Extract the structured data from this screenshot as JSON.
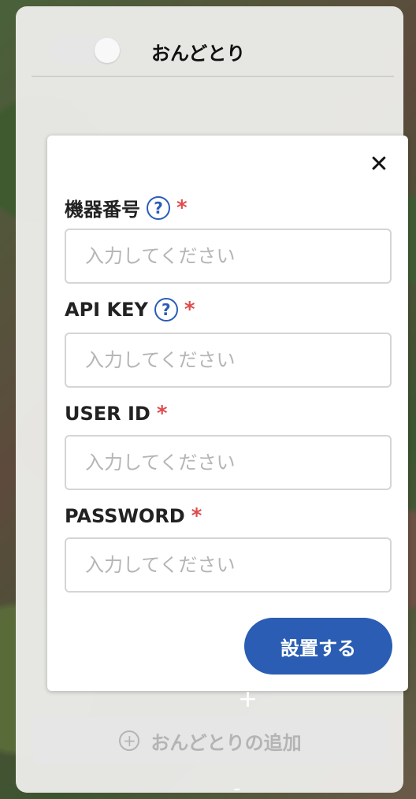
{
  "header": {
    "device_name": "おんどとり"
  },
  "form": {
    "close_icon": "close-icon",
    "fields": [
      {
        "label": "機器番号",
        "help": "?",
        "required": "*",
        "placeholder": "入力してください"
      },
      {
        "label": "API KEY",
        "help": "?",
        "required": "*",
        "placeholder": "入力してください"
      },
      {
        "label": "USER ID",
        "required": "*",
        "placeholder": "入力してください"
      },
      {
        "label": "PASSWORD",
        "required": "*",
        "placeholder": "入力してください"
      }
    ],
    "submit_label": "設置する"
  },
  "add_device": {
    "label": "おんどとりの追加",
    "icon": "plus-circle-icon"
  },
  "colors": {
    "accent": "#2a5db3",
    "required": "#e04b4b"
  }
}
